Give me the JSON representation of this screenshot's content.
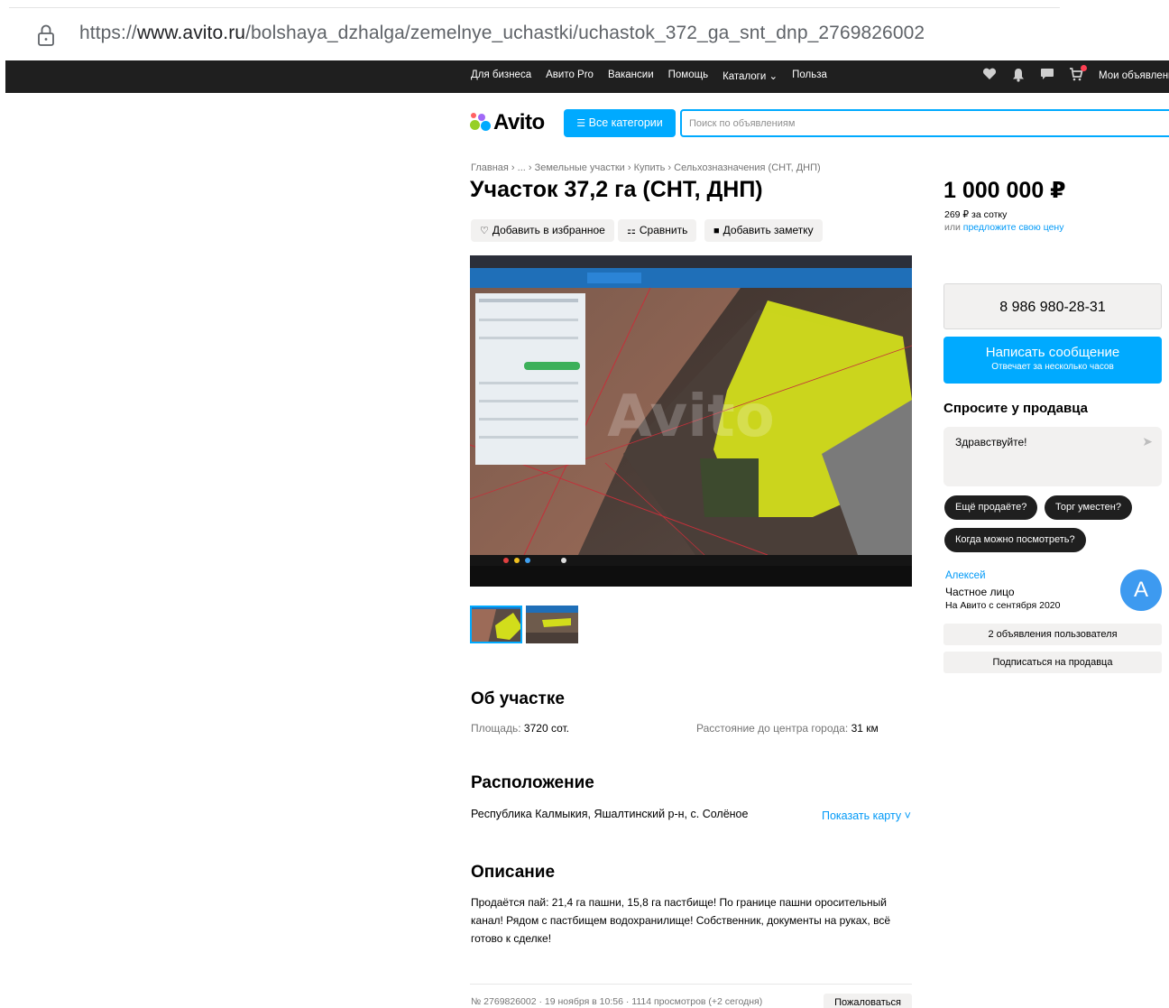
{
  "browser": {
    "url_prefix": "https://",
    "url_domain": "www.avito.ru",
    "url_path": "/bolshaya_dzhalga/zemelnye_uchastki/uchastok_372_ga_snt_dnp_2769826002",
    "lock_icon": "lock-icon"
  },
  "topnav": {
    "links": [
      "Для бизнеса",
      "Авито Pro",
      "Вакансии",
      "Помощь",
      "Каталоги ⌄",
      "Польза"
    ],
    "icons": [
      "heart-icon",
      "bell-icon",
      "chat-icon",
      "cart-icon"
    ],
    "my_ads": "Мои объявления"
  },
  "header": {
    "logo_text": "Avito",
    "all_categories": "Все категории",
    "search_placeholder": "Поиск по объявлениям"
  },
  "breadcrumbs": "Главная › ... › Земельные участки › Купить › Сельхозназначения (СНТ, ДНП)",
  "listing": {
    "title": "Участок 37,2 га (СНТ, ДНП)",
    "add_favorite": "Добавить в избранное",
    "compare": "Сравнить",
    "add_note": "Добавить заметку",
    "photo_watermark": "Avito",
    "thumbnail_count": 2
  },
  "about": {
    "heading": "Об участке",
    "area_label": "Площадь:",
    "area_value": "3720 сот.",
    "distance_label": "Расстояние до центра города:",
    "distance_value": "31 км"
  },
  "location": {
    "heading": "Расположение",
    "address": "Республика Калмыкия, Яшалтинский р-н, с. Солёное",
    "show_map": "Показать карту ˅"
  },
  "description": {
    "heading": "Описание",
    "text": "Продаётся пай: 21,4 га пашни, 15,8 га пастбище! По границе пашни оросительный канал! Рядом с пастбищем водохранилище! Собственник, документы на руках, всё готово к сделке!"
  },
  "footer": {
    "meta": "№ 2769826002 · 19 ноября в 10:56 · 1114 просмотров (+2 сегодня)",
    "complain": "Пожаловаться"
  },
  "sidebar": {
    "price": "1 000 000 ₽",
    "per_sotka": "269 ₽ за сотку",
    "offer_prefix": "или ",
    "offer_link": "предложите свою цену",
    "phone": "8 986 980-28-31",
    "write_message": "Написать сообщение",
    "responds": "Отвечает за несколько часов",
    "ask_heading": "Спросите у продавца",
    "ask_text": "Здравствуйте!",
    "chips": [
      "Ещё продаёте?",
      "Торг уместен?",
      "Когда можно посмотреть?"
    ],
    "seller_name": "Алексей",
    "seller_type": "Частное лицо",
    "seller_since": "На Авито с сентября 2020",
    "avatar_letter": "А",
    "user_ads": "2 объявления пользователя",
    "subscribe": "Подписаться на продавца"
  },
  "colors": {
    "accent": "#00aaff",
    "link": "#0099f7",
    "nav_bg": "#1f1f1f",
    "avatar": "#3d9af0"
  }
}
